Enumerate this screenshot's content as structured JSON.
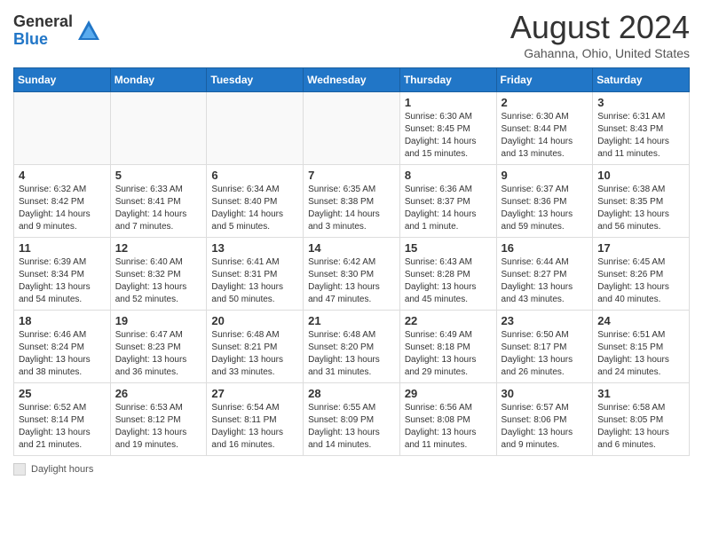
{
  "header": {
    "logo_general": "General",
    "logo_blue": "Blue",
    "month_year": "August 2024",
    "location": "Gahanna, Ohio, United States"
  },
  "weekdays": [
    "Sunday",
    "Monday",
    "Tuesday",
    "Wednesday",
    "Thursday",
    "Friday",
    "Saturday"
  ],
  "legend": {
    "label": "Daylight hours"
  },
  "weeks": [
    [
      {
        "day": "",
        "info": ""
      },
      {
        "day": "",
        "info": ""
      },
      {
        "day": "",
        "info": ""
      },
      {
        "day": "",
        "info": ""
      },
      {
        "day": "1",
        "info": "Sunrise: 6:30 AM\nSunset: 8:45 PM\nDaylight: 14 hours and 15 minutes."
      },
      {
        "day": "2",
        "info": "Sunrise: 6:30 AM\nSunset: 8:44 PM\nDaylight: 14 hours and 13 minutes."
      },
      {
        "day": "3",
        "info": "Sunrise: 6:31 AM\nSunset: 8:43 PM\nDaylight: 14 hours and 11 minutes."
      }
    ],
    [
      {
        "day": "4",
        "info": "Sunrise: 6:32 AM\nSunset: 8:42 PM\nDaylight: 14 hours and 9 minutes."
      },
      {
        "day": "5",
        "info": "Sunrise: 6:33 AM\nSunset: 8:41 PM\nDaylight: 14 hours and 7 minutes."
      },
      {
        "day": "6",
        "info": "Sunrise: 6:34 AM\nSunset: 8:40 PM\nDaylight: 14 hours and 5 minutes."
      },
      {
        "day": "7",
        "info": "Sunrise: 6:35 AM\nSunset: 8:38 PM\nDaylight: 14 hours and 3 minutes."
      },
      {
        "day": "8",
        "info": "Sunrise: 6:36 AM\nSunset: 8:37 PM\nDaylight: 14 hours and 1 minute."
      },
      {
        "day": "9",
        "info": "Sunrise: 6:37 AM\nSunset: 8:36 PM\nDaylight: 13 hours and 59 minutes."
      },
      {
        "day": "10",
        "info": "Sunrise: 6:38 AM\nSunset: 8:35 PM\nDaylight: 13 hours and 56 minutes."
      }
    ],
    [
      {
        "day": "11",
        "info": "Sunrise: 6:39 AM\nSunset: 8:34 PM\nDaylight: 13 hours and 54 minutes."
      },
      {
        "day": "12",
        "info": "Sunrise: 6:40 AM\nSunset: 8:32 PM\nDaylight: 13 hours and 52 minutes."
      },
      {
        "day": "13",
        "info": "Sunrise: 6:41 AM\nSunset: 8:31 PM\nDaylight: 13 hours and 50 minutes."
      },
      {
        "day": "14",
        "info": "Sunrise: 6:42 AM\nSunset: 8:30 PM\nDaylight: 13 hours and 47 minutes."
      },
      {
        "day": "15",
        "info": "Sunrise: 6:43 AM\nSunset: 8:28 PM\nDaylight: 13 hours and 45 minutes."
      },
      {
        "day": "16",
        "info": "Sunrise: 6:44 AM\nSunset: 8:27 PM\nDaylight: 13 hours and 43 minutes."
      },
      {
        "day": "17",
        "info": "Sunrise: 6:45 AM\nSunset: 8:26 PM\nDaylight: 13 hours and 40 minutes."
      }
    ],
    [
      {
        "day": "18",
        "info": "Sunrise: 6:46 AM\nSunset: 8:24 PM\nDaylight: 13 hours and 38 minutes."
      },
      {
        "day": "19",
        "info": "Sunrise: 6:47 AM\nSunset: 8:23 PM\nDaylight: 13 hours and 36 minutes."
      },
      {
        "day": "20",
        "info": "Sunrise: 6:48 AM\nSunset: 8:21 PM\nDaylight: 13 hours and 33 minutes."
      },
      {
        "day": "21",
        "info": "Sunrise: 6:48 AM\nSunset: 8:20 PM\nDaylight: 13 hours and 31 minutes."
      },
      {
        "day": "22",
        "info": "Sunrise: 6:49 AM\nSunset: 8:18 PM\nDaylight: 13 hours and 29 minutes."
      },
      {
        "day": "23",
        "info": "Sunrise: 6:50 AM\nSunset: 8:17 PM\nDaylight: 13 hours and 26 minutes."
      },
      {
        "day": "24",
        "info": "Sunrise: 6:51 AM\nSunset: 8:15 PM\nDaylight: 13 hours and 24 minutes."
      }
    ],
    [
      {
        "day": "25",
        "info": "Sunrise: 6:52 AM\nSunset: 8:14 PM\nDaylight: 13 hours and 21 minutes."
      },
      {
        "day": "26",
        "info": "Sunrise: 6:53 AM\nSunset: 8:12 PM\nDaylight: 13 hours and 19 minutes."
      },
      {
        "day": "27",
        "info": "Sunrise: 6:54 AM\nSunset: 8:11 PM\nDaylight: 13 hours and 16 minutes."
      },
      {
        "day": "28",
        "info": "Sunrise: 6:55 AM\nSunset: 8:09 PM\nDaylight: 13 hours and 14 minutes."
      },
      {
        "day": "29",
        "info": "Sunrise: 6:56 AM\nSunset: 8:08 PM\nDaylight: 13 hours and 11 minutes."
      },
      {
        "day": "30",
        "info": "Sunrise: 6:57 AM\nSunset: 8:06 PM\nDaylight: 13 hours and 9 minutes."
      },
      {
        "day": "31",
        "info": "Sunrise: 6:58 AM\nSunset: 8:05 PM\nDaylight: 13 hours and 6 minutes."
      }
    ]
  ]
}
